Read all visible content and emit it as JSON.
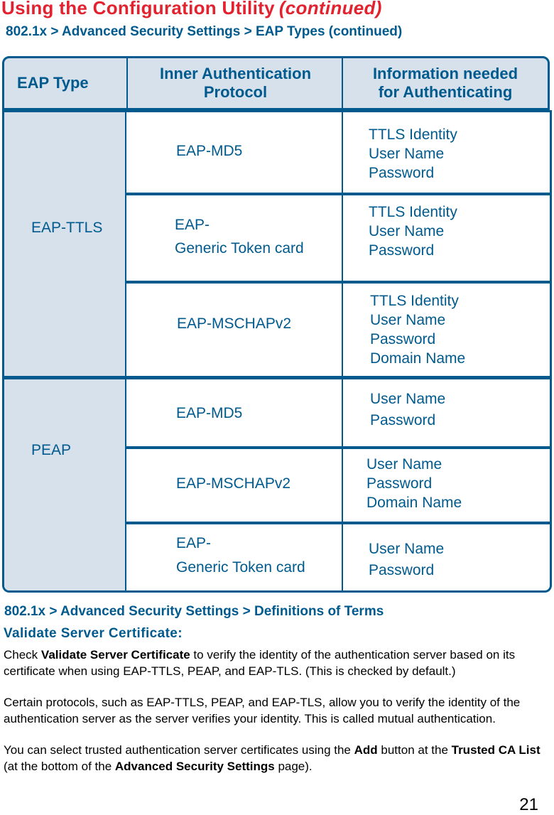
{
  "page": {
    "title": "Using the Configuration Utility",
    "title_suffix": "(continued)",
    "subtitle": "802.1x > Advanced Security Settings > EAP Types (continued)",
    "page_number": "21"
  },
  "table": {
    "headers": [
      "EAP Type",
      "Inner Authentication Protocol",
      "Information needed for Authenticating"
    ],
    "header_lines": {
      "col2": [
        "Inner Authentication",
        "Protocol"
      ],
      "col3": [
        "Information needed",
        "for Authenticating"
      ]
    },
    "groups": [
      {
        "eap_type": "EAP-TTLS",
        "rows": [
          {
            "protocol": [
              "EAP-MD5"
            ],
            "info": [
              "TTLS Identity",
              "User Name",
              "Password"
            ]
          },
          {
            "protocol": [
              "EAP-",
              "Generic Token card"
            ],
            "info": [
              "TTLS Identity",
              "User Name",
              "Password"
            ]
          },
          {
            "protocol": [
              "EAP-MSCHAPv2"
            ],
            "info": [
              "TTLS Identity",
              "User Name",
              "Password",
              "Domain Name"
            ]
          }
        ]
      },
      {
        "eap_type": "PEAP",
        "rows": [
          {
            "protocol": [
              "EAP-MD5"
            ],
            "info": [
              "User Name",
              "Password"
            ]
          },
          {
            "protocol": [
              "EAP-MSCHAPv2"
            ],
            "info": [
              "User Name",
              "Password",
              "Domain Name"
            ]
          },
          {
            "protocol": [
              "EAP-",
              "Generic Token card"
            ],
            "info": [
              "User Name",
              "Password"
            ]
          }
        ]
      }
    ]
  },
  "definitions": {
    "title": "802.1x > Advanced Security Settings > Definitions of Terms",
    "term": "Validate Server Certificate:",
    "p1": {
      "pre": "Check ",
      "bold": "Validate Server Certificate",
      "post": " to verify the identity of the authentication server based on its certificate when using EAP-TTLS, PEAP, and EAP-TLS. (This is checked by default.)"
    },
    "p2": "Certain protocols, such as EAP-TTLS, PEAP, and EAP-TLS, allow you to verify the identity of the authentication server as the server verifies your identity. This is called mutual authentication.",
    "p3": {
      "pre": "You can select trusted authentication server certificates using the ",
      "bold1": "Add",
      "mid1": " button at the ",
      "bold2": "Trusted CA List",
      "mid2": " (at the bottom of the ",
      "bold3": "Advanced Security Settings",
      "post": " page)."
    }
  },
  "colors": {
    "title_red": "#e2222e",
    "brand_blue": "#005a8e",
    "cell_shade": "#d6e1ec"
  }
}
